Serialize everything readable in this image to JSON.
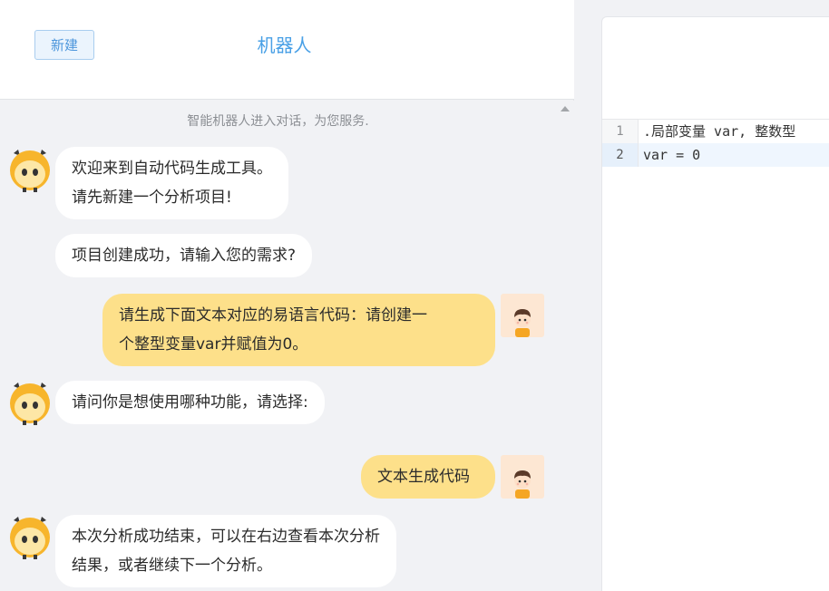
{
  "header": {
    "new_label": "新建",
    "title": "机器人"
  },
  "chat": {
    "notice": "智能机器人进入对话，为您服务.",
    "messages": [
      {
        "lines": [
          "欢迎来到自动代码生成工具。",
          "请先新建一个分析项目!"
        ]
      },
      {
        "lines": [
          "项目创建成功，请输入您的需求?"
        ]
      },
      {
        "lines": [
          "请生成下面文本对应的易语言代码：请创建一",
          "个整型变量var并赋值为0。"
        ]
      },
      {
        "lines": [
          "请问你是想使用哪种功能，请选择:"
        ]
      },
      {
        "lines": [
          "文本生成代码"
        ]
      },
      {
        "lines": [
          "本次分析成功结束，可以在右边查看本次分析",
          "结果，或者继续下一个分析。"
        ]
      }
    ]
  },
  "editor": {
    "lines": [
      {
        "num": "1",
        "text": ".局部变量 var, 整数型"
      },
      {
        "num": "2",
        "text": "var = 0"
      }
    ]
  },
  "colors": {
    "accent": "#49a0e6",
    "user_bubble": "#fde08a",
    "bot_bubble": "#ffffff",
    "background": "#f1f2f5"
  },
  "icons": {
    "bot_avatar": "owl-robot-icon",
    "user_avatar": "user-boy-icon",
    "scroll": "scroll-up-arrow-icon"
  }
}
